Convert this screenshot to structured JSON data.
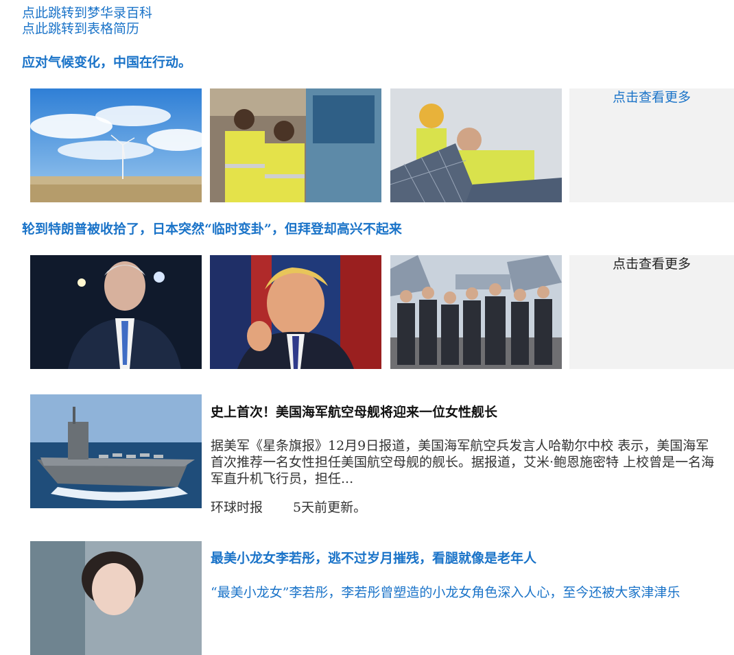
{
  "links": {
    "encyclopedia": "点此跳转到梦华录百科",
    "resume": "点此跳转到表格简历"
  },
  "sections": [
    {
      "title": "应对气候变化，中国在行动。",
      "more": "点击查看更多",
      "images": [
        "wind-turbine-photo",
        "railway-workers-photo",
        "solar-panel-workers-photo"
      ]
    },
    {
      "title": "轮到特朗普被收拾了，日本突然“临时变卦”，但拜登却高兴不起来",
      "more": "点击查看更多",
      "images": [
        "biden-photo",
        "trump-photo",
        "navy-officials-photo"
      ]
    }
  ],
  "articles": [
    {
      "title": "史上首次！美国海军航空母舰将迎来一位女性舰长",
      "summary": "据美军《星条旗报》12月9日报道，美国海军航空兵发言人哈勒尔中校 表示，美国海军首次推荐一名女性担任美国航空母舰的舰长。据报道，艾米·鲍恩施密特 上校曾是一名海军直升机飞行员，担任...",
      "source": "环球时报",
      "time": "5天前更新。"
    },
    {
      "title": "最美小龙女李若彤，逃不过岁月摧残，看腿就像是老年人",
      "summary": "“最美小龙女”李若彤，李若彤曾塑造的小龙女角色深入人心，至今还被大家津津乐"
    }
  ],
  "colors": {
    "link": "#1a73c8",
    "more_bg": "#f2f2f2"
  }
}
